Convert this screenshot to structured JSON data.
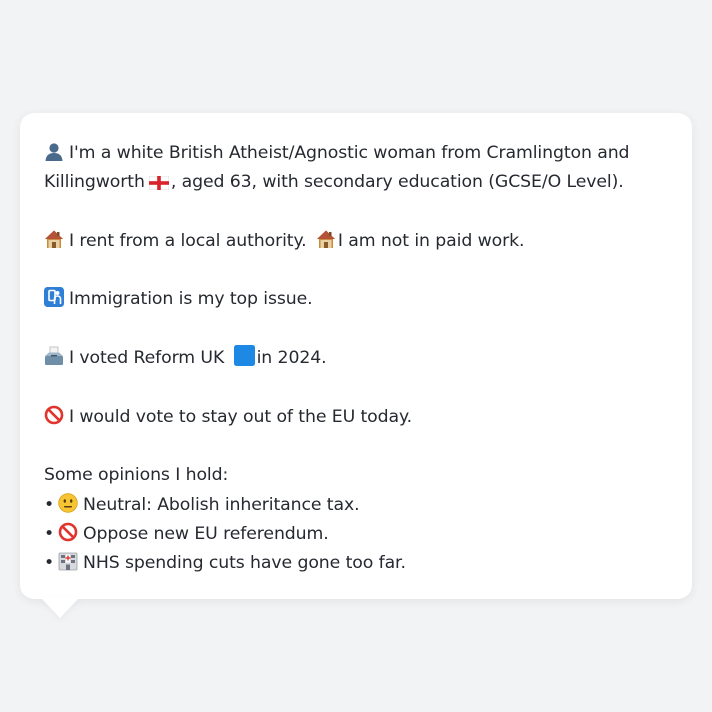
{
  "profile": {
    "intro_line1": "I'm a white British Atheist/Agnostic woman from Cramlington and",
    "intro_line2_a": "Killingworth",
    "intro_line2_b": ", aged 63, with secondary education (GCSE/O Level).",
    "housing_a": "I rent from a local authority.",
    "housing_b": "I am not in paid work.",
    "issue": "Immigration is my top issue.",
    "vote_a": "I voted Reform UK",
    "vote_b": "in 2024.",
    "eu": "I would vote to stay out of the EU today.",
    "opinions_heading": "Some opinions I hold:",
    "opinions": [
      {
        "bullet": "•",
        "text": "Neutral: Abolish inheritance tax.",
        "icon": "neutral-face-icon"
      },
      {
        "bullet": "•",
        "text": "Oppose new EU referendum.",
        "icon": "prohibited-icon"
      },
      {
        "bullet": "•",
        "text": "NHS spending cuts have gone too far.",
        "icon": "hospital-icon"
      }
    ]
  },
  "icons": {
    "person": "bust-silhouette-icon",
    "flag": "england-flag-icon",
    "house": "house-icon",
    "passport": "passport-control-icon",
    "ballot": "ballot-box-icon",
    "party_color": "blue-square-icon",
    "prohibited": "prohibited-icon"
  },
  "colors": {
    "background": "#f2f3f5",
    "bubble": "#ffffff",
    "text": "#262a30",
    "party_blue": "#1e88e5"
  }
}
